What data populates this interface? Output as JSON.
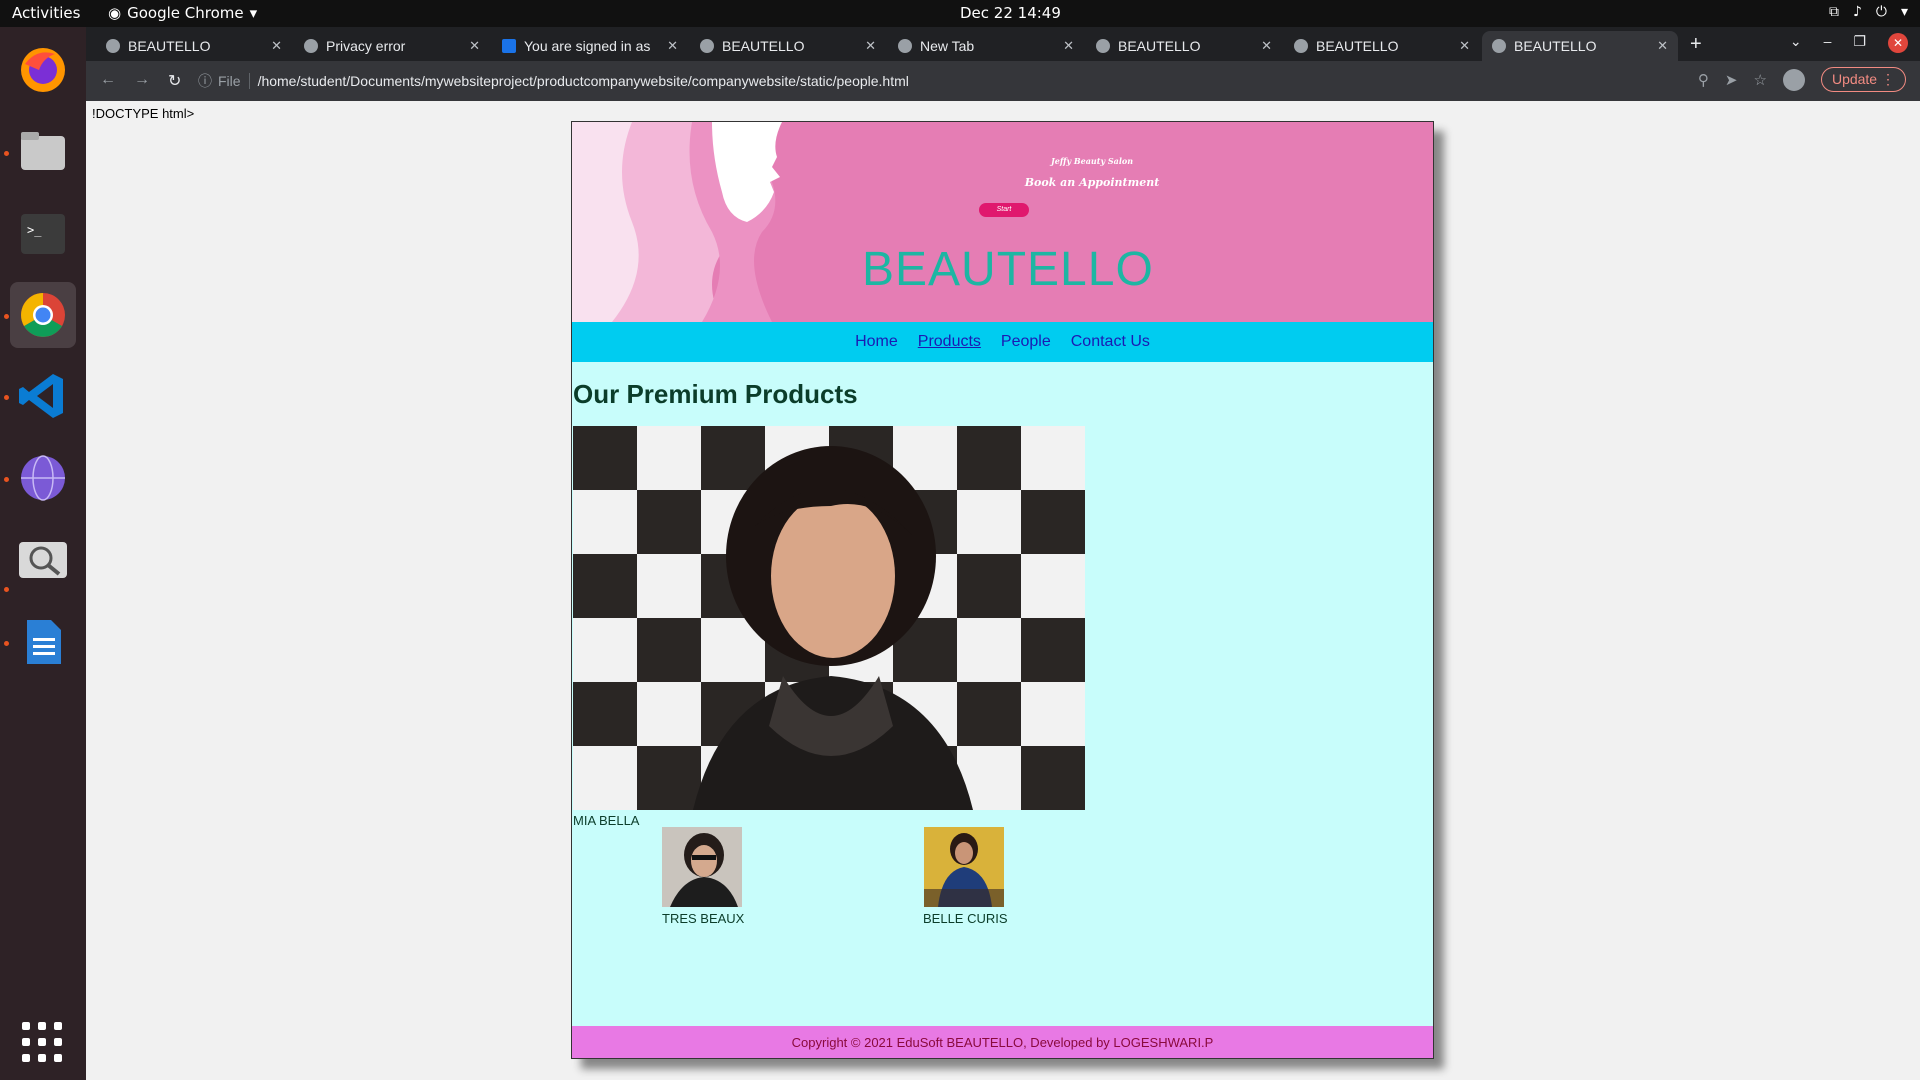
{
  "topbar": {
    "activities": "Activities",
    "app": "Google Chrome",
    "clock": "Dec 22  14:49"
  },
  "tabs": [
    {
      "label": "BEAUTELLO"
    },
    {
      "label": "Privacy error"
    },
    {
      "label": "You are signed in as"
    },
    {
      "label": "BEAUTELLO"
    },
    {
      "label": "New Tab"
    },
    {
      "label": "BEAUTELLO"
    },
    {
      "label": "BEAUTELLO"
    },
    {
      "label": "BEAUTELLO"
    }
  ],
  "toolbar": {
    "file_label": "File",
    "url": "/home/student/Documents/mywebsiteproject/productcompanywebsite/companywebsite/static/people.html",
    "update_label": "Update"
  },
  "page": {
    "doctype_text": "!DOCTYPE html>",
    "banner": {
      "tagline": "Jeffy Beauty Salon",
      "book": "Book an Appointment",
      "start": "Start",
      "brand": "BEAUTELLO"
    },
    "nav": [
      "Home",
      "Products",
      "People",
      "Contact Us"
    ],
    "heading": "Our Premium Products",
    "hero_caption": "MIA BELLA",
    "thumbs": [
      {
        "caption": "TRES BEAUX"
      },
      {
        "caption": "BELLE CURIS"
      }
    ],
    "footer": "Copyright © 2021 EduSoft BEAUTELLO, Developed by LOGESHWARI.P"
  },
  "colors": {
    "banner": "#e57db4",
    "nav": "#00ccf0",
    "content": "#c8fdfb",
    "footer": "#e879e4",
    "brand": "#1db6a3"
  }
}
